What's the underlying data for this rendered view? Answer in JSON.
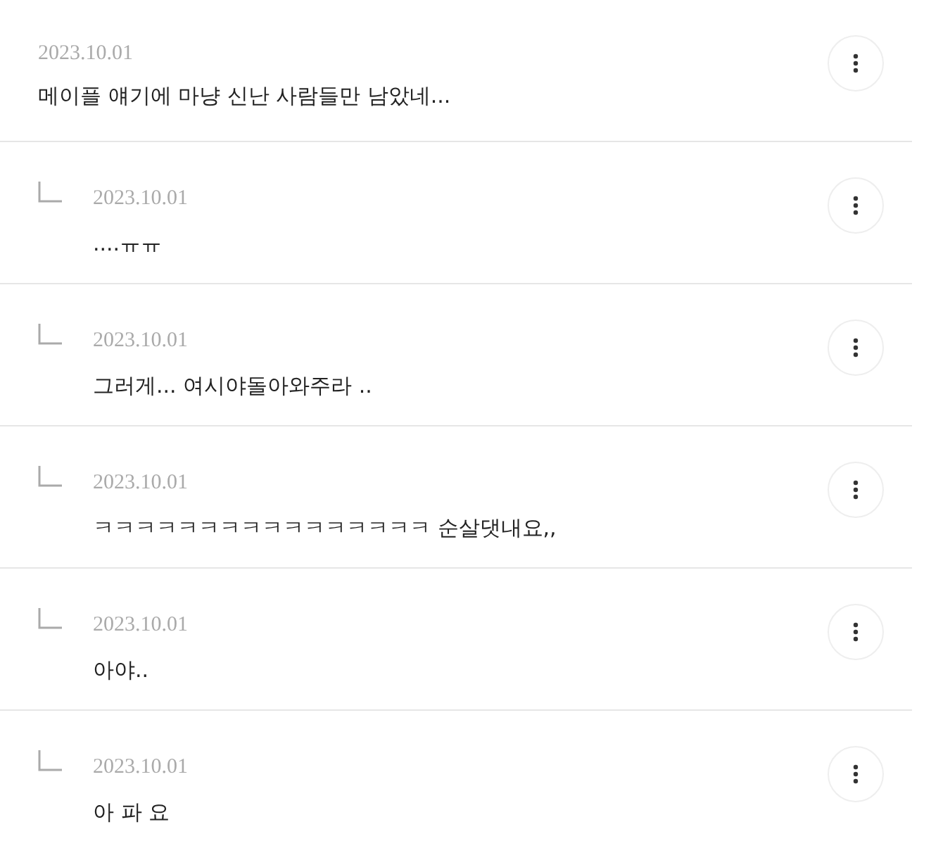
{
  "comments": [
    {
      "kind": "comment",
      "date": "2023.10.01",
      "text": "메이플 얘기에 마냥 신난 사람들만 남았네..."
    },
    {
      "kind": "reply",
      "date": "2023.10.01",
      "text": "....ㅠㅠ"
    },
    {
      "kind": "reply",
      "date": "2023.10.01",
      "text": "그러게... 여시야돌아와주라 .."
    },
    {
      "kind": "reply",
      "date": "2023.10.01",
      "text": "ㅋㅋㅋㅋㅋㅋㅋㅋㅋㅋㅋㅋㅋㅋㅋㅋ 순살댓내요,,"
    },
    {
      "kind": "reply",
      "date": "2023.10.01",
      "text": "아야.."
    },
    {
      "kind": "reply",
      "date": "2023.10.01",
      "text": "아 파 요"
    }
  ]
}
